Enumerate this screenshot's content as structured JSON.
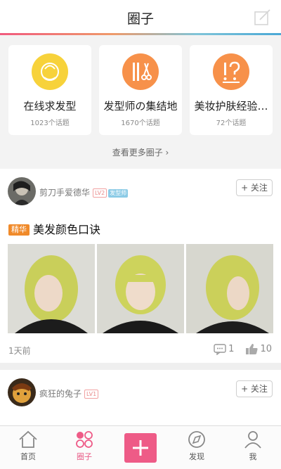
{
  "header": {
    "title": "圈子"
  },
  "circles": [
    {
      "name": "在线求发型",
      "count": "1023个话题",
      "color": "#f7d23b",
      "icon": "hair-search-icon"
    },
    {
      "name": "发型师の集结地",
      "count": "1670个话题",
      "color": "#f7914a",
      "icon": "barber-tools-icon"
    },
    {
      "name": "美妆护肤经验…",
      "count": "72个话题",
      "color": "#f7914a",
      "icon": "question-icon"
    }
  ],
  "more_circles": "查看更多圈子 ›",
  "posts": [
    {
      "username": "剪刀手爱德华",
      "level": "LV2",
      "role_tag": "发型师",
      "follow": "+ 关注",
      "badge": "精华",
      "title": "美发颜色口诀",
      "time": "1天前",
      "comments": "1",
      "likes": "10"
    },
    {
      "username": "疯狂的兔子",
      "level": "LV1",
      "follow": "+ 关注"
    }
  ],
  "tabs": [
    {
      "label": "首页",
      "icon": "home-icon"
    },
    {
      "label": "圈子",
      "icon": "circles-icon"
    },
    {
      "label": "",
      "icon": "plus-icon"
    },
    {
      "label": "发现",
      "icon": "compass-icon"
    },
    {
      "label": "我",
      "icon": "user-icon"
    }
  ],
  "colors": {
    "accent": "#ee5b87",
    "yellow": "#f7d23b",
    "orange": "#f7914a"
  }
}
